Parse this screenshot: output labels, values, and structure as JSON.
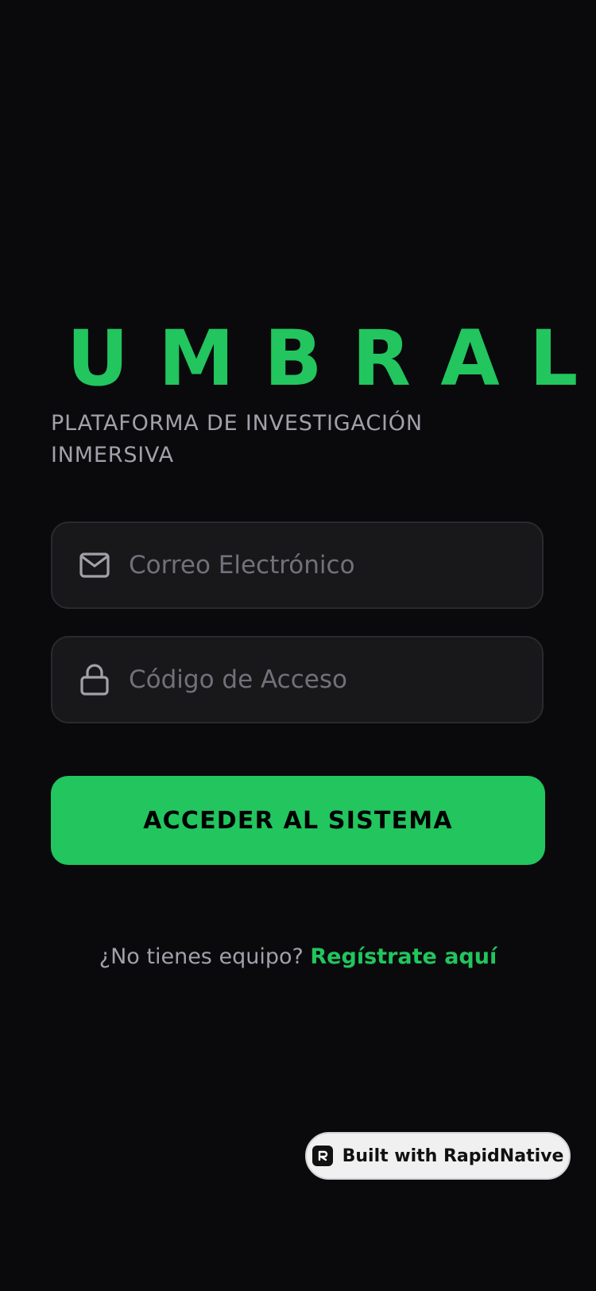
{
  "brand": {
    "title": "UMBRAL",
    "subtitle": "PLATAFORMA DE INVESTIGACIÓN INMERSIVA"
  },
  "form": {
    "email": {
      "placeholder": "Correo Electrónico",
      "value": "",
      "icon": "mail-icon"
    },
    "code": {
      "placeholder": "Código de Acceso",
      "value": "",
      "icon": "lock-icon"
    },
    "submit_label": "ACCEDER AL SISTEMA"
  },
  "register": {
    "prompt": "¿No tienes equipo? ",
    "link_label": "Regístrate aquí"
  },
  "badge": {
    "label": "Built with RapidNative",
    "icon": "rapidnative-logo-icon"
  },
  "colors": {
    "accent": "#22c55e",
    "background": "#0a0a0c",
    "field_background": "#18181b",
    "muted_text": "#a1a1aa",
    "placeholder_text": "#71717a"
  }
}
